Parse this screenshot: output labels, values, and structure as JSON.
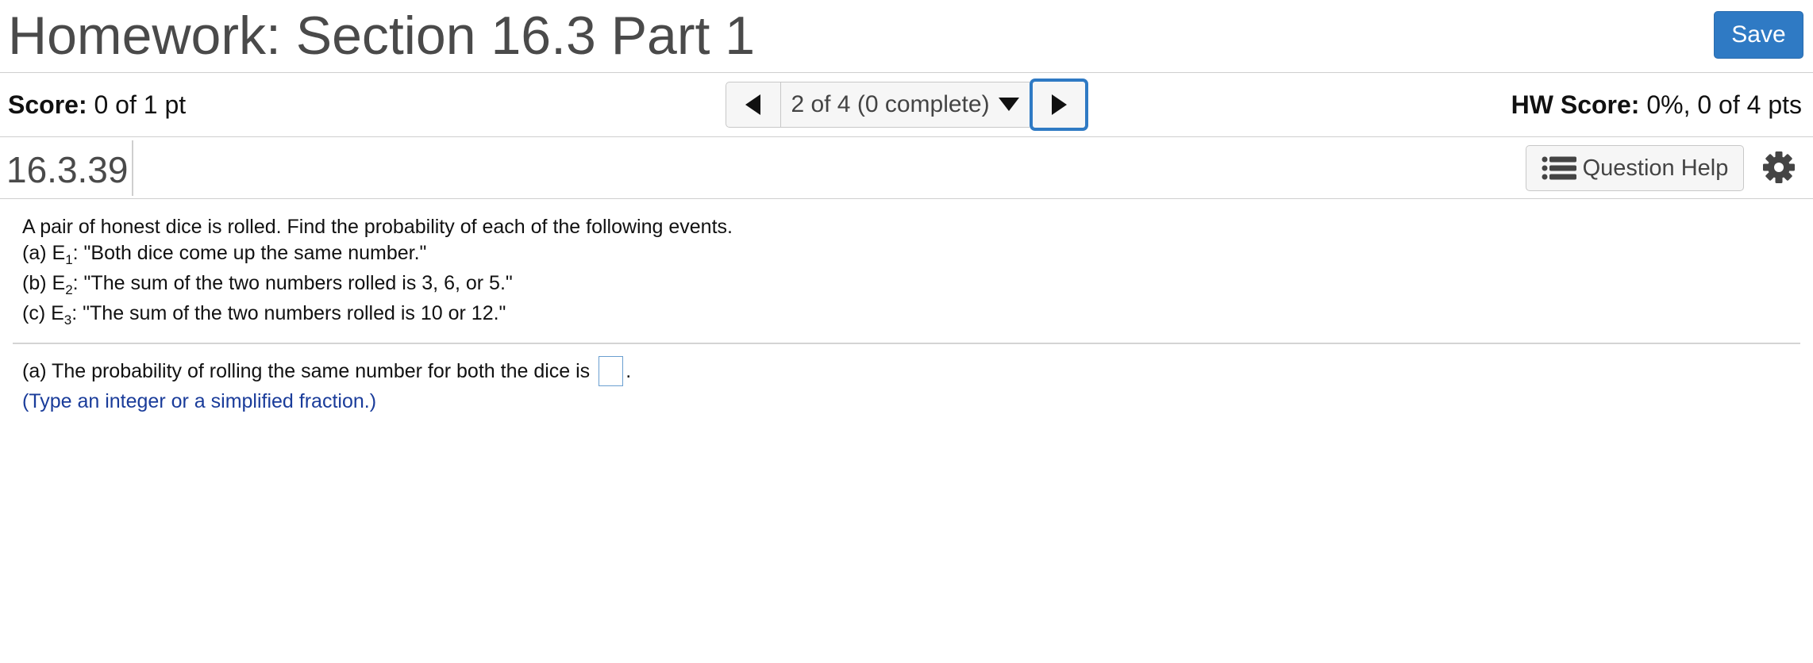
{
  "header": {
    "title": "Homework: Section 16.3 Part 1",
    "save_label": "Save"
  },
  "score_bar": {
    "score_label": "Score:",
    "score_value": "0 of 1 pt",
    "nav_position": "2 of 4 (0 complete)",
    "hw_score_label": "HW Score:",
    "hw_score_value": "0%, 0 of 4 pts"
  },
  "question_header": {
    "number": "16.3.39",
    "help_label": "Question Help"
  },
  "question": {
    "intro": "A pair of honest dice is rolled. Find the probability of each of the following events.",
    "parts": [
      {
        "prefix": "(a) E",
        "sub": "1",
        "text": ": \"Both dice come up the same number.\""
      },
      {
        "prefix": "(b) E",
        "sub": "2",
        "text": ": \"The sum of the two numbers rolled is 3, 6, or 5.\""
      },
      {
        "prefix": "(c) E",
        "sub": "3",
        "text": ": \"The sum of the two numbers rolled is 10 or 12.\""
      }
    ]
  },
  "answer": {
    "prompt": "(a) The probability of rolling the same number for both the dice is",
    "value": "",
    "suffix": ".",
    "hint": "(Type an integer or a simplified fraction.)"
  },
  "icons": {
    "prev": "triangle-left-icon",
    "next": "triangle-right-icon",
    "dropdown": "caret-down-icon",
    "help": "list-icon",
    "settings": "gear-icon"
  },
  "colors": {
    "accent": "#2f7ac4",
    "hint_text": "#1a3c9a",
    "title_text": "#4a4a4a"
  }
}
